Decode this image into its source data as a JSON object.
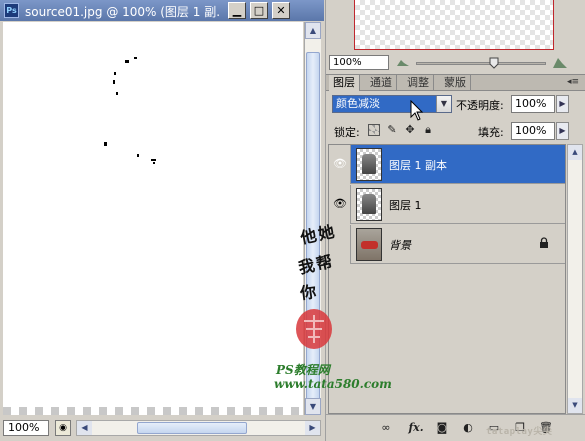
{
  "document": {
    "title": "source01.jpg @ 100% (图层 1 副...",
    "zoom": "100%"
  },
  "navigator": {
    "zoom": "100%"
  },
  "layers_panel": {
    "tabs": [
      "图层",
      "通道",
      "调整",
      "蒙版"
    ],
    "blend_mode": "颜色减淡",
    "opacity_label": "不透明度:",
    "opacity": "100%",
    "lock_label": "锁定:",
    "fill_label": "填充:",
    "fill": "100%",
    "layers": [
      {
        "name": "图层 1 副本",
        "visible": true,
        "selected": true
      },
      {
        "name": "图层 1",
        "visible": true,
        "selected": false
      },
      {
        "name": "背景",
        "visible": false,
        "selected": false,
        "locked": true
      }
    ]
  },
  "watermark": {
    "line1": "他她",
    "line2": "我帮",
    "line3": "你",
    "site_cn": "PS教程网",
    "site_url": "www.tata580.com",
    "corner": "tataplay尖尖"
  },
  "colors": {
    "selection": "#316ac5",
    "titlebar": "#6a86bb",
    "seal": "#d8373b",
    "watermark_green": "#2c7d2c"
  },
  "icons": [
    "photoshop-icon",
    "minimize-icon",
    "maximize-icon",
    "close-icon",
    "eye-icon",
    "lock-icon",
    "link-icon",
    "fx-icon",
    "mask-icon",
    "adjustment-icon",
    "folder-icon",
    "new-layer-icon",
    "trash-icon"
  ]
}
